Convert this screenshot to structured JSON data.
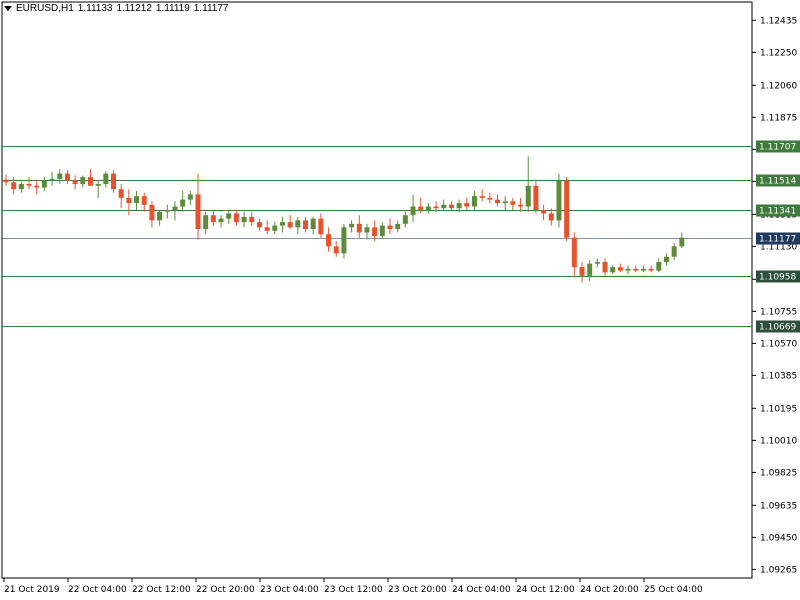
{
  "header": {
    "symbol": "EURUSD,H1",
    "open": "1.11133",
    "high": "1.11212",
    "low": "1.11119",
    "close": "1.11177",
    "menu_icon": "triangle-down-icon"
  },
  "colors": {
    "bull": "#5e8b3b",
    "bear": "#e5532d",
    "level_line": "#3f7a3f",
    "level_tag": "#3f7a3f",
    "support_tag": "#2d4f3e",
    "current_tag": "#1f3a5f",
    "axis": "#000000"
  },
  "chart_data": {
    "type": "candlestick",
    "title": "EURUSD,H1",
    "y_ticks": [
      "1.12435",
      "1.12250",
      "1.12060",
      "1.11875",
      "1.11690",
      "1.11505",
      "1.11315",
      "1.11130",
      "1.10940",
      "1.10755",
      "1.10570",
      "1.10385",
      "1.10195",
      "1.10010",
      "1.09825",
      "1.09635",
      "1.09450",
      "1.09265"
    ],
    "ylim": [
      1.0925,
      1.1246
    ],
    "x_ticks": [
      "21 Oct 2019",
      "22 Oct 04:00",
      "22 Oct 12:00",
      "22 Oct 20:00",
      "23 Oct 04:00",
      "23 Oct 12:00",
      "23 Oct 20:00",
      "24 Oct 04:00",
      "24 Oct 12:00",
      "24 Oct 20:00",
      "25 Oct 04:00"
    ],
    "levels": [
      {
        "label": "1.11707",
        "value": 1.11707,
        "style": "resistance"
      },
      {
        "label": "1.11514",
        "value": 1.11514,
        "style": "resistance"
      },
      {
        "label": "1.11341",
        "value": 1.11341,
        "style": "resistance"
      },
      {
        "label": "1.10958",
        "value": 1.10958,
        "style": "support"
      },
      {
        "label": "1.10669",
        "value": 1.10669,
        "style": "support"
      }
    ],
    "current_price": {
      "label": "1.11177",
      "value": 1.11177
    },
    "candles": [
      {
        "o": 1.11515,
        "h": 1.11545,
        "l": 1.1148,
        "c": 1.115
      },
      {
        "o": 1.115,
        "h": 1.1153,
        "l": 1.1143,
        "c": 1.1146
      },
      {
        "o": 1.1146,
        "h": 1.115,
        "l": 1.1144,
        "c": 1.1149
      },
      {
        "o": 1.1149,
        "h": 1.1153,
        "l": 1.1146,
        "c": 1.1148
      },
      {
        "o": 1.1148,
        "h": 1.1151,
        "l": 1.1143,
        "c": 1.1147
      },
      {
        "o": 1.1147,
        "h": 1.1153,
        "l": 1.1145,
        "c": 1.1151
      },
      {
        "o": 1.1151,
        "h": 1.1156,
        "l": 1.1148,
        "c": 1.1152
      },
      {
        "o": 1.1152,
        "h": 1.11575,
        "l": 1.1149,
        "c": 1.1155
      },
      {
        "o": 1.1155,
        "h": 1.1157,
        "l": 1.1149,
        "c": 1.1151
      },
      {
        "o": 1.1151,
        "h": 1.1154,
        "l": 1.1146,
        "c": 1.1149
      },
      {
        "o": 1.1149,
        "h": 1.1154,
        "l": 1.1147,
        "c": 1.1153
      },
      {
        "o": 1.1153,
        "h": 1.11575,
        "l": 1.1148,
        "c": 1.1148
      },
      {
        "o": 1.1148,
        "h": 1.1151,
        "l": 1.1141,
        "c": 1.1149
      },
      {
        "o": 1.1149,
        "h": 1.11565,
        "l": 1.1147,
        "c": 1.1155
      },
      {
        "o": 1.1155,
        "h": 1.1157,
        "l": 1.1144,
        "c": 1.1146
      },
      {
        "o": 1.1146,
        "h": 1.1149,
        "l": 1.1135,
        "c": 1.1141
      },
      {
        "o": 1.1141,
        "h": 1.1146,
        "l": 1.1131,
        "c": 1.1138
      },
      {
        "o": 1.1138,
        "h": 1.1145,
        "l": 1.1134,
        "c": 1.1142
      },
      {
        "o": 1.1142,
        "h": 1.1144,
        "l": 1.1133,
        "c": 1.1137
      },
      {
        "o": 1.1137,
        "h": 1.1139,
        "l": 1.1124,
        "c": 1.1128
      },
      {
        "o": 1.1128,
        "h": 1.1134,
        "l": 1.1125,
        "c": 1.1133
      },
      {
        "o": 1.1133,
        "h": 1.1137,
        "l": 1.1129,
        "c": 1.1134
      },
      {
        "o": 1.1134,
        "h": 1.1139,
        "l": 1.1128,
        "c": 1.1136
      },
      {
        "o": 1.1136,
        "h": 1.1145,
        "l": 1.1133,
        "c": 1.114
      },
      {
        "o": 1.114,
        "h": 1.1145,
        "l": 1.1137,
        "c": 1.1143
      },
      {
        "o": 1.1143,
        "h": 1.1155,
        "l": 1.1117,
        "c": 1.1123
      },
      {
        "o": 1.1123,
        "h": 1.1133,
        "l": 1.112,
        "c": 1.1131
      },
      {
        "o": 1.1131,
        "h": 1.1134,
        "l": 1.1125,
        "c": 1.1127
      },
      {
        "o": 1.1127,
        "h": 1.1131,
        "l": 1.1124,
        "c": 1.1129
      },
      {
        "o": 1.1129,
        "h": 1.1134,
        "l": 1.1126,
        "c": 1.1132
      },
      {
        "o": 1.1132,
        "h": 1.1134,
        "l": 1.1125,
        "c": 1.1127
      },
      {
        "o": 1.1127,
        "h": 1.1133,
        "l": 1.1124,
        "c": 1.113
      },
      {
        "o": 1.113,
        "h": 1.1133,
        "l": 1.1125,
        "c": 1.1127
      },
      {
        "o": 1.1127,
        "h": 1.1129,
        "l": 1.1122,
        "c": 1.1124
      },
      {
        "o": 1.1124,
        "h": 1.1128,
        "l": 1.112,
        "c": 1.1122
      },
      {
        "o": 1.1122,
        "h": 1.1127,
        "l": 1.112,
        "c": 1.1125
      },
      {
        "o": 1.1125,
        "h": 1.113,
        "l": 1.1121,
        "c": 1.1127
      },
      {
        "o": 1.1127,
        "h": 1.1131,
        "l": 1.1123,
        "c": 1.1124
      },
      {
        "o": 1.1124,
        "h": 1.113,
        "l": 1.112,
        "c": 1.1128
      },
      {
        "o": 1.1128,
        "h": 1.113,
        "l": 1.1121,
        "c": 1.1123
      },
      {
        "o": 1.1123,
        "h": 1.113,
        "l": 1.112,
        "c": 1.1129
      },
      {
        "o": 1.1129,
        "h": 1.1132,
        "l": 1.1118,
        "c": 1.112
      },
      {
        "o": 1.112,
        "h": 1.1124,
        "l": 1.111,
        "c": 1.1113
      },
      {
        "o": 1.1113,
        "h": 1.1116,
        "l": 1.1107,
        "c": 1.1109
      },
      {
        "o": 1.1109,
        "h": 1.1126,
        "l": 1.1106,
        "c": 1.1124
      },
      {
        "o": 1.1124,
        "h": 1.1128,
        "l": 1.1121,
        "c": 1.1126
      },
      {
        "o": 1.1126,
        "h": 1.1131,
        "l": 1.1118,
        "c": 1.1121
      },
      {
        "o": 1.1121,
        "h": 1.1126,
        "l": 1.1117,
        "c": 1.1124
      },
      {
        "o": 1.1124,
        "h": 1.1128,
        "l": 1.1116,
        "c": 1.1119
      },
      {
        "o": 1.1119,
        "h": 1.1127,
        "l": 1.1118,
        "c": 1.1125
      },
      {
        "o": 1.1125,
        "h": 1.1129,
        "l": 1.112,
        "c": 1.1123
      },
      {
        "o": 1.1123,
        "h": 1.1128,
        "l": 1.1121,
        "c": 1.1126
      },
      {
        "o": 1.1126,
        "h": 1.1133,
        "l": 1.1124,
        "c": 1.1131
      },
      {
        "o": 1.1131,
        "h": 1.1143,
        "l": 1.1127,
        "c": 1.1136
      },
      {
        "o": 1.1136,
        "h": 1.1141,
        "l": 1.1132,
        "c": 1.1134
      },
      {
        "o": 1.1134,
        "h": 1.1138,
        "l": 1.1132,
        "c": 1.1136
      },
      {
        "o": 1.1136,
        "h": 1.1139,
        "l": 1.1133,
        "c": 1.1135
      },
      {
        "o": 1.1135,
        "h": 1.114,
        "l": 1.1134,
        "c": 1.1137
      },
      {
        "o": 1.1137,
        "h": 1.1139,
        "l": 1.1134,
        "c": 1.1135
      },
      {
        "o": 1.1135,
        "h": 1.114,
        "l": 1.1133,
        "c": 1.1138
      },
      {
        "o": 1.1138,
        "h": 1.1141,
        "l": 1.1134,
        "c": 1.1136
      },
      {
        "o": 1.1136,
        "h": 1.1145,
        "l": 1.1134,
        "c": 1.1142
      },
      {
        "o": 1.1142,
        "h": 1.1146,
        "l": 1.1139,
        "c": 1.1141
      },
      {
        "o": 1.1141,
        "h": 1.1144,
        "l": 1.1138,
        "c": 1.114
      },
      {
        "o": 1.114,
        "h": 1.1143,
        "l": 1.1136,
        "c": 1.1138
      },
      {
        "o": 1.1138,
        "h": 1.1142,
        "l": 1.1134,
        "c": 1.1139
      },
      {
        "o": 1.1139,
        "h": 1.1141,
        "l": 1.1134,
        "c": 1.1137
      },
      {
        "o": 1.1137,
        "h": 1.1141,
        "l": 1.1133,
        "c": 1.1136
      },
      {
        "o": 1.1136,
        "h": 1.1165,
        "l": 1.1133,
        "c": 1.1148
      },
      {
        "o": 1.1148,
        "h": 1.1151,
        "l": 1.1132,
        "c": 1.1134
      },
      {
        "o": 1.1134,
        "h": 1.1137,
        "l": 1.1128,
        "c": 1.1132
      },
      {
        "o": 1.1132,
        "h": 1.1135,
        "l": 1.1125,
        "c": 1.1128
      },
      {
        "o": 1.1128,
        "h": 1.1155,
        "l": 1.1124,
        "c": 1.1151
      },
      {
        "o": 1.1151,
        "h": 1.1153,
        "l": 1.1116,
        "c": 1.1118
      },
      {
        "o": 1.1118,
        "h": 1.1121,
        "l": 1.1095,
        "c": 1.1101
      },
      {
        "o": 1.1101,
        "h": 1.1104,
        "l": 1.1092,
        "c": 1.1096
      },
      {
        "o": 1.1096,
        "h": 1.1105,
        "l": 1.1093,
        "c": 1.1103
      },
      {
        "o": 1.1103,
        "h": 1.1106,
        "l": 1.1101,
        "c": 1.1104
      },
      {
        "o": 1.1104,
        "h": 1.1106,
        "l": 1.1095,
        "c": 1.1098
      },
      {
        "o": 1.1098,
        "h": 1.1102,
        "l": 1.1097,
        "c": 1.1101
      },
      {
        "o": 1.1101,
        "h": 1.1103,
        "l": 1.1098,
        "c": 1.1099
      },
      {
        "o": 1.1099,
        "h": 1.1102,
        "l": 1.1097,
        "c": 1.11
      },
      {
        "o": 1.11,
        "h": 1.1102,
        "l": 1.1098,
        "c": 1.1099
      },
      {
        "o": 1.1099,
        "h": 1.1102,
        "l": 1.1098,
        "c": 1.11
      },
      {
        "o": 1.11,
        "h": 1.1102,
        "l": 1.1098,
        "c": 1.1099
      },
      {
        "o": 1.1099,
        "h": 1.1106,
        "l": 1.1098,
        "c": 1.1104
      },
      {
        "o": 1.1104,
        "h": 1.1109,
        "l": 1.1102,
        "c": 1.1107
      },
      {
        "o": 1.1107,
        "h": 1.1115,
        "l": 1.1105,
        "c": 1.1113
      },
      {
        "o": 1.1113,
        "h": 1.1121,
        "l": 1.1112,
        "c": 1.1118
      }
    ]
  }
}
